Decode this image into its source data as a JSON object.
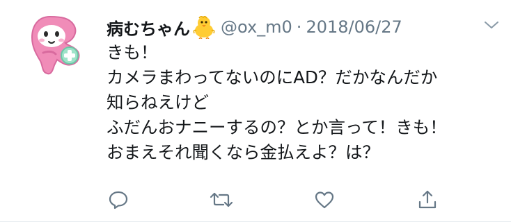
{
  "tweet": {
    "display_name": "病むちゃん",
    "handle": "@ox_m0",
    "separator": "·",
    "date": "2018/06/27",
    "lines": [
      "きも！",
      "カメラまわってないのにAD？だかなんだか",
      "知らねえけど",
      "ふだんおナニーするの？とか言って！きも！",
      "おまえそれ聞くなら金払えよ？は？"
    ]
  },
  "icons": {
    "name_emoji": "baby-chick-emoji",
    "menu": "chevron-down-icon",
    "reply": "reply-icon",
    "retweet": "retweet-icon",
    "like": "heart-icon",
    "share": "share-icon"
  },
  "colors": {
    "text": "#14171a",
    "secondary": "#657786",
    "action_icon": "#657786",
    "avatar_pink": "#f08cb8",
    "avatar_mint": "#9fe3c9"
  }
}
